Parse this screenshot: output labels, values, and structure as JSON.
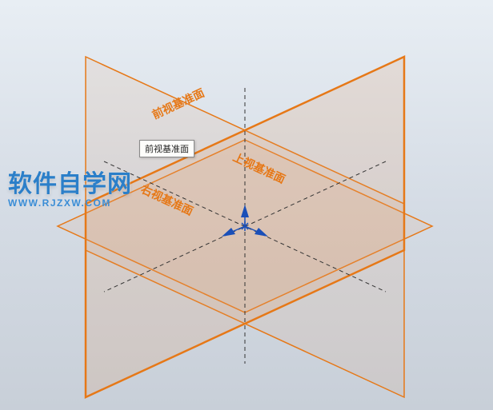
{
  "watermark": {
    "title": "软件自学网",
    "url": "WWW.RJZXW.COM"
  },
  "tooltip": {
    "text": "前视基准面"
  },
  "planes": {
    "front": {
      "label": "前视基准面"
    },
    "top": {
      "label": "上视基准面"
    },
    "right": {
      "label": "右视基准面"
    }
  },
  "colors": {
    "plane_edge": "#e67817",
    "axis": "#1a4fb8"
  }
}
